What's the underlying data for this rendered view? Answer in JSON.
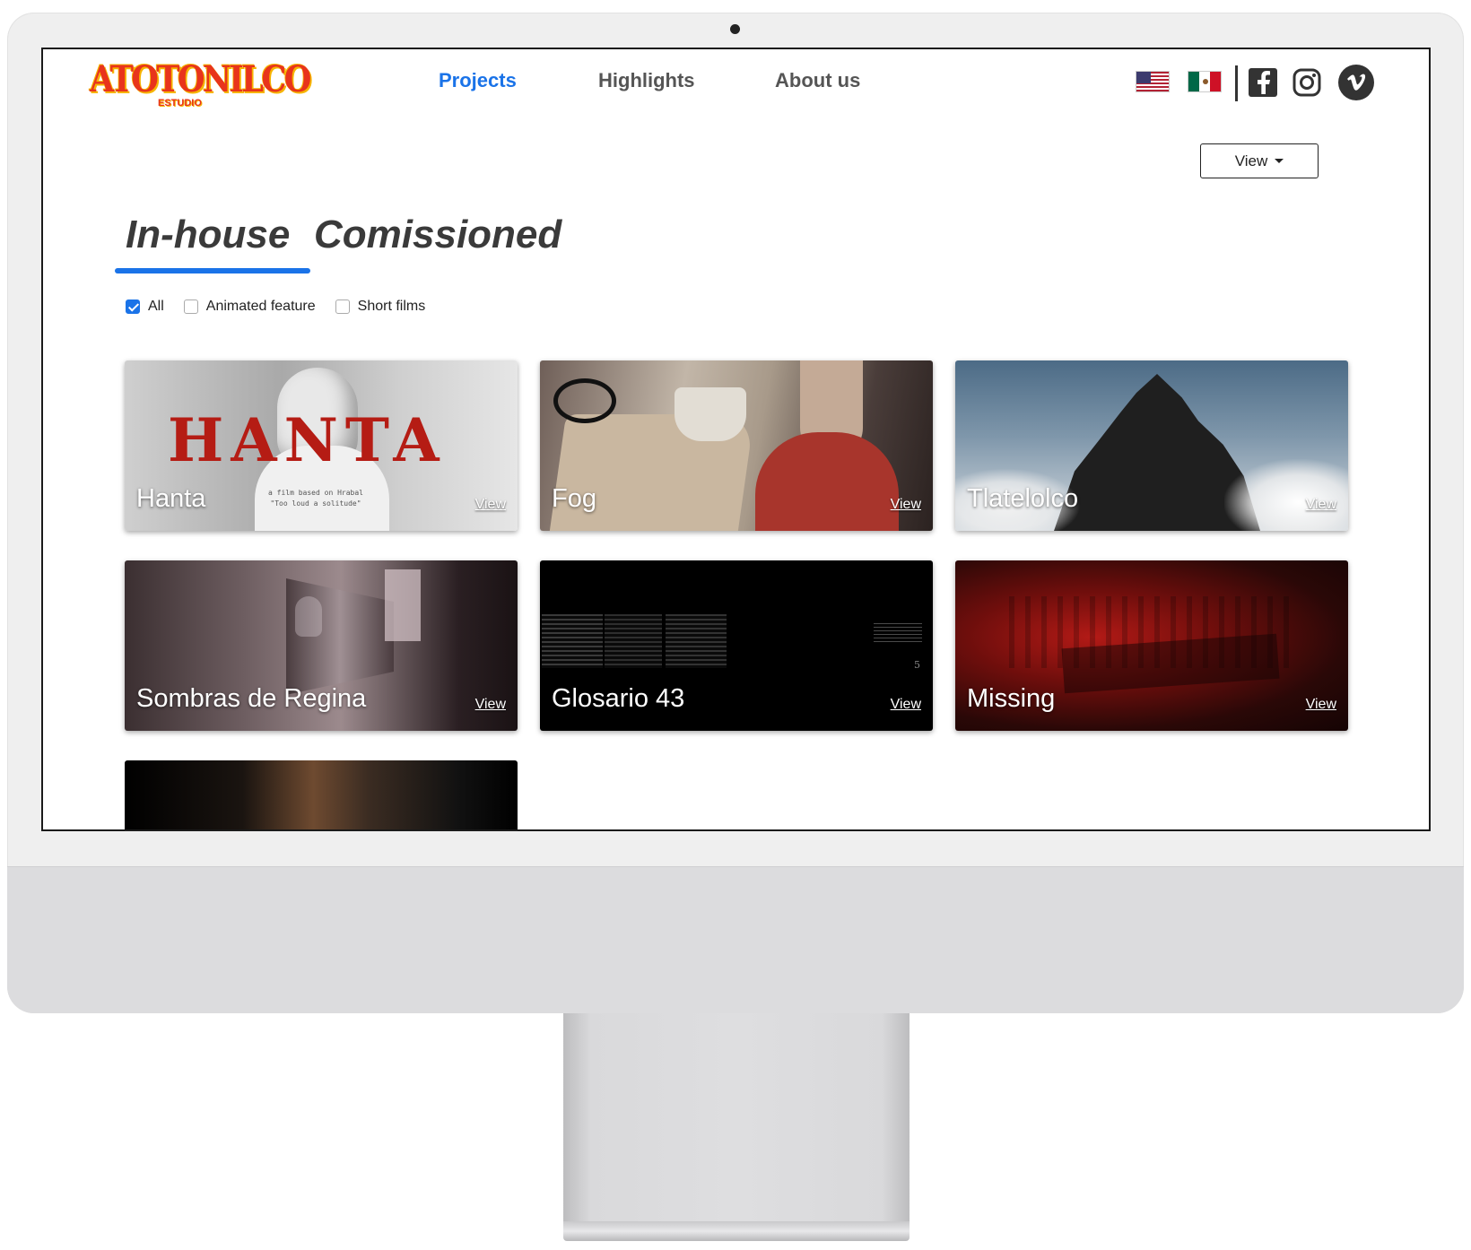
{
  "brand": {
    "logo_main": "ATOTONILCO",
    "logo_sub": "ESTUDIO"
  },
  "nav": {
    "items": [
      {
        "label": "Projects",
        "active": true
      },
      {
        "label": "Highlights",
        "active": false
      },
      {
        "label": "About us",
        "active": false
      }
    ]
  },
  "languages": [
    "us-flag-icon",
    "mx-flag-icon"
  ],
  "social": [
    "facebook-icon",
    "instagram-icon",
    "vimeo-icon"
  ],
  "view_dropdown": {
    "label": "View"
  },
  "tabs": [
    {
      "label": "In-house",
      "active": true
    },
    {
      "label": "Comissioned",
      "active": false
    }
  ],
  "filters": [
    {
      "label": "All",
      "checked": true
    },
    {
      "label": "Animated feature",
      "checked": false
    },
    {
      "label": "Short films",
      "checked": false
    }
  ],
  "projects": [
    {
      "title": "Hanta",
      "link": "View",
      "poster_text": "HANTA",
      "tagline_1": "a film based on Hrabal",
      "tagline_2": "\"Too loud a solitude\""
    },
    {
      "title": "Fog",
      "link": "View"
    },
    {
      "title": "Tlatelolco",
      "link": "View"
    },
    {
      "title": "Sombras de Regina",
      "link": "View"
    },
    {
      "title": "Glosario 43",
      "link": "View",
      "page_number": "5"
    },
    {
      "title": "Missing",
      "link": "View"
    },
    {
      "title": "",
      "link": ""
    }
  ],
  "colors": {
    "accent": "#1a73e8",
    "nav_inactive": "#555555",
    "tab_text": "#3a3a3a",
    "logo_red": "#e8341c",
    "logo_yellow": "#f6b400"
  }
}
